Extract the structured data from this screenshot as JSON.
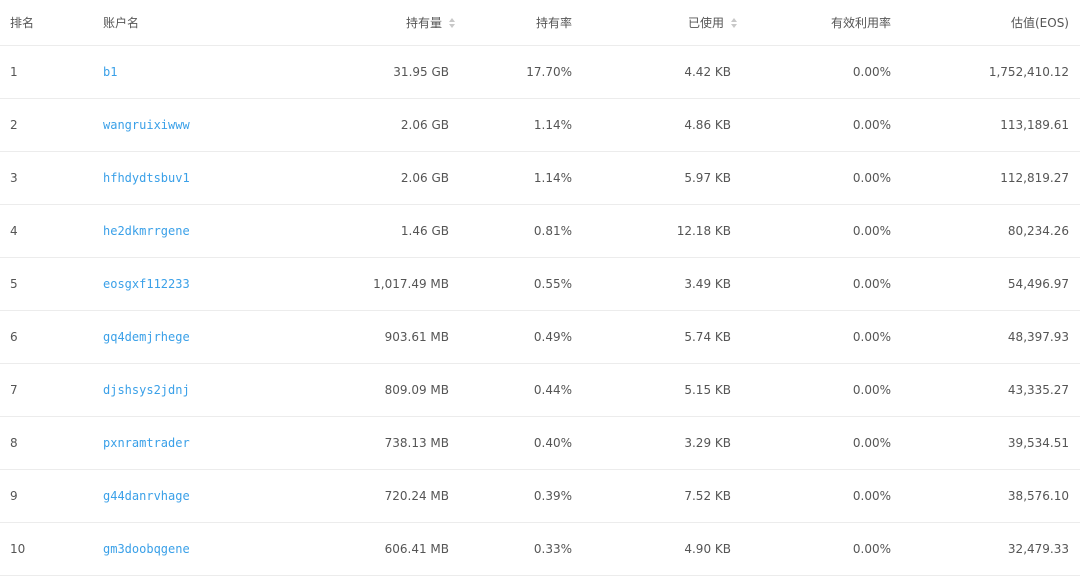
{
  "table": {
    "headers": {
      "rank": "排名",
      "account": "账户名",
      "holding": "持有量",
      "holding_rate": "持有率",
      "used": "已使用",
      "efficiency": "有效利用率",
      "value": "估值(EOS)"
    },
    "sortable": [
      "holding",
      "used"
    ],
    "colors": {
      "link": "#3aa0e8",
      "text": "#555555",
      "divider": "#ececec"
    },
    "rows": [
      {
        "rank": "1",
        "account": "b1",
        "holding": "31.95 GB",
        "holding_rate": "17.70%",
        "used": "4.42 KB",
        "efficiency": "0.00%",
        "value": "1,752,410.12"
      },
      {
        "rank": "2",
        "account": "wangruixiwww",
        "holding": "2.06 GB",
        "holding_rate": "1.14%",
        "used": "4.86 KB",
        "efficiency": "0.00%",
        "value": "113,189.61"
      },
      {
        "rank": "3",
        "account": "hfhdydtsbuv1",
        "holding": "2.06 GB",
        "holding_rate": "1.14%",
        "used": "5.97 KB",
        "efficiency": "0.00%",
        "value": "112,819.27"
      },
      {
        "rank": "4",
        "account": "he2dkmrrgene",
        "holding": "1.46 GB",
        "holding_rate": "0.81%",
        "used": "12.18 KB",
        "efficiency": "0.00%",
        "value": "80,234.26"
      },
      {
        "rank": "5",
        "account": "eosgxf112233",
        "holding": "1,017.49 MB",
        "holding_rate": "0.55%",
        "used": "3.49 KB",
        "efficiency": "0.00%",
        "value": "54,496.97"
      },
      {
        "rank": "6",
        "account": "gq4demjrhege",
        "holding": "903.61 MB",
        "holding_rate": "0.49%",
        "used": "5.74 KB",
        "efficiency": "0.00%",
        "value": "48,397.93"
      },
      {
        "rank": "7",
        "account": "djshsys2jdnj",
        "holding": "809.09 MB",
        "holding_rate": "0.44%",
        "used": "5.15 KB",
        "efficiency": "0.00%",
        "value": "43,335.27"
      },
      {
        "rank": "8",
        "account": "pxnramtrader",
        "holding": "738.13 MB",
        "holding_rate": "0.40%",
        "used": "3.29 KB",
        "efficiency": "0.00%",
        "value": "39,534.51"
      },
      {
        "rank": "9",
        "account": "g44danrvhage",
        "holding": "720.24 MB",
        "holding_rate": "0.39%",
        "used": "7.52 KB",
        "efficiency": "0.00%",
        "value": "38,576.10"
      },
      {
        "rank": "10",
        "account": "gm3doobqgene",
        "holding": "606.41 MB",
        "holding_rate": "0.33%",
        "used": "4.90 KB",
        "efficiency": "0.00%",
        "value": "32,479.33"
      }
    ]
  }
}
